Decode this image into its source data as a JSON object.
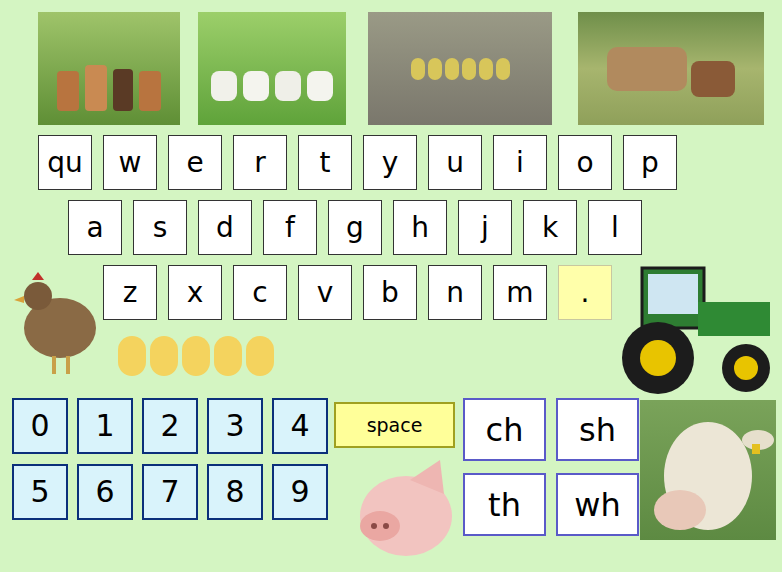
{
  "keyboard": {
    "rows": [
      [
        {
          "label": "qu",
          "kind": "letter"
        },
        {
          "label": "w",
          "kind": "letter"
        },
        {
          "label": "e",
          "kind": "letter"
        },
        {
          "label": "r",
          "kind": "letter"
        },
        {
          "label": "t",
          "kind": "letter"
        },
        {
          "label": "y",
          "kind": "letter"
        },
        {
          "label": "u",
          "kind": "letter"
        },
        {
          "label": "i",
          "kind": "letter"
        },
        {
          "label": "o",
          "kind": "letter"
        },
        {
          "label": "p",
          "kind": "letter"
        }
      ],
      [
        {
          "label": "a",
          "kind": "letter"
        },
        {
          "label": "s",
          "kind": "letter"
        },
        {
          "label": "d",
          "kind": "letter"
        },
        {
          "label": "f",
          "kind": "letter"
        },
        {
          "label": "g",
          "kind": "letter"
        },
        {
          "label": "h",
          "kind": "letter"
        },
        {
          "label": "j",
          "kind": "letter"
        },
        {
          "label": "k",
          "kind": "letter"
        },
        {
          "label": "l",
          "kind": "letter"
        }
      ],
      [
        {
          "label": "z",
          "kind": "letter"
        },
        {
          "label": "x",
          "kind": "letter"
        },
        {
          "label": "c",
          "kind": "letter"
        },
        {
          "label": "v",
          "kind": "letter"
        },
        {
          "label": "b",
          "kind": "letter"
        },
        {
          "label": "n",
          "kind": "letter"
        },
        {
          "label": "m",
          "kind": "letter"
        },
        {
          "label": ".",
          "kind": "punctuation"
        }
      ]
    ]
  },
  "numbers": [
    "0",
    "1",
    "2",
    "3",
    "4",
    "5",
    "6",
    "7",
    "8",
    "9"
  ],
  "space": {
    "label": "space"
  },
  "digraphs": [
    "ch",
    "sh",
    "th",
    "wh"
  ]
}
